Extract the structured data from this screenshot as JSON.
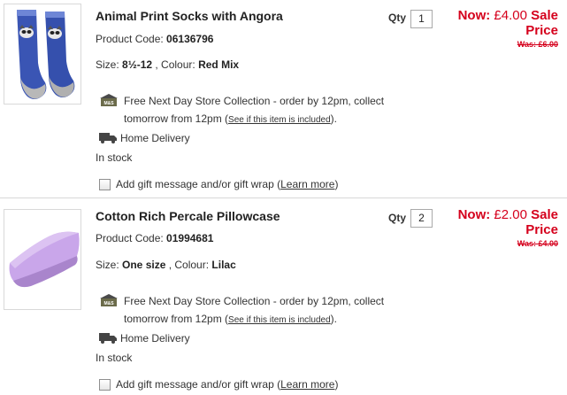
{
  "items": [
    {
      "title": "Animal Print Socks with Angora",
      "code_label": "Product Code: ",
      "code": "06136796",
      "size_label": "Size: ",
      "size": "8½-12",
      "colour_label": " , Colour: ",
      "colour": "Red Mix",
      "qty_label": "Qty",
      "qty": "1",
      "now_label": "Now: ",
      "now_price": "£4.00",
      "sale_label": "Sale Price",
      "was_price": "Was: £6.00",
      "collection_text": "Free Next Day Store Collection - order by 12pm, collect tomorrow from 12pm (",
      "collection_link": "See if this item is included",
      "collection_end": ").",
      "delivery_label": "Home Delivery",
      "stock": "In stock",
      "gift_text": "Add gift message and/or gift wrap (",
      "gift_link": "Learn more",
      "gift_end": ")"
    },
    {
      "title": "Cotton Rich Percale Pillowcase",
      "code_label": "Product Code: ",
      "code": "01994681",
      "size_label": "Size: ",
      "size": "One size",
      "colour_label": " , Colour: ",
      "colour": "Lilac",
      "qty_label": "Qty",
      "qty": "2",
      "now_label": "Now: ",
      "now_price": "£2.00",
      "sale_label": "Sale Price",
      "was_price": "Was: £4.00",
      "collection_text": "Free Next Day Store Collection - order by 12pm, collect tomorrow from 12pm (",
      "collection_link": "See if this item is included",
      "collection_end": ").",
      "delivery_label": "Home Delivery",
      "stock": "In stock",
      "gift_text": "Add gift message and/or gift wrap (",
      "gift_link": "Learn more",
      "gift_end": ")"
    }
  ],
  "icons": {
    "store": "ms-store-icon",
    "van": "delivery-van-icon"
  },
  "colors": {
    "price_red": "#d5001c",
    "text": "#333333",
    "sock_blue": "#3a55b4",
    "pillow_lilac": "#c8a3e8"
  }
}
